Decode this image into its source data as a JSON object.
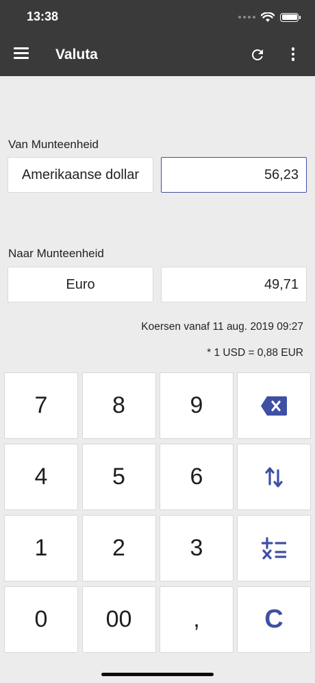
{
  "status_bar": {
    "time": "13:38"
  },
  "appbar": {
    "title": "Valuta",
    "menu_icon": "menu-icon",
    "refresh_icon": "refresh-icon",
    "more_icon": "more-vert-icon"
  },
  "from": {
    "label": "Van Munteenheid",
    "currency": "Amerikaanse dollar",
    "amount": "56,23"
  },
  "to": {
    "label": "Naar Munteenheid",
    "currency": "Euro",
    "amount": "49,71"
  },
  "rates_info": "Koersen vanaf 11 aug. 2019 09:27",
  "rate_line": "* 1 USD = 0,88 EUR",
  "keypad": {
    "k7": "7",
    "k8": "8",
    "k9": "9",
    "k4": "4",
    "k5": "5",
    "k6": "6",
    "k1": "1",
    "k2": "2",
    "k3": "3",
    "k0": "0",
    "k00": "00",
    "comma": ",",
    "clear": "C",
    "backspace_icon": "backspace-icon",
    "swap_icon": "swap-vertical-icon",
    "calc_icon": "calculator-operations-icon"
  },
  "colors": {
    "appbar": "#3a3a3a",
    "accent": "#3f4fa3",
    "background": "#ececec"
  }
}
